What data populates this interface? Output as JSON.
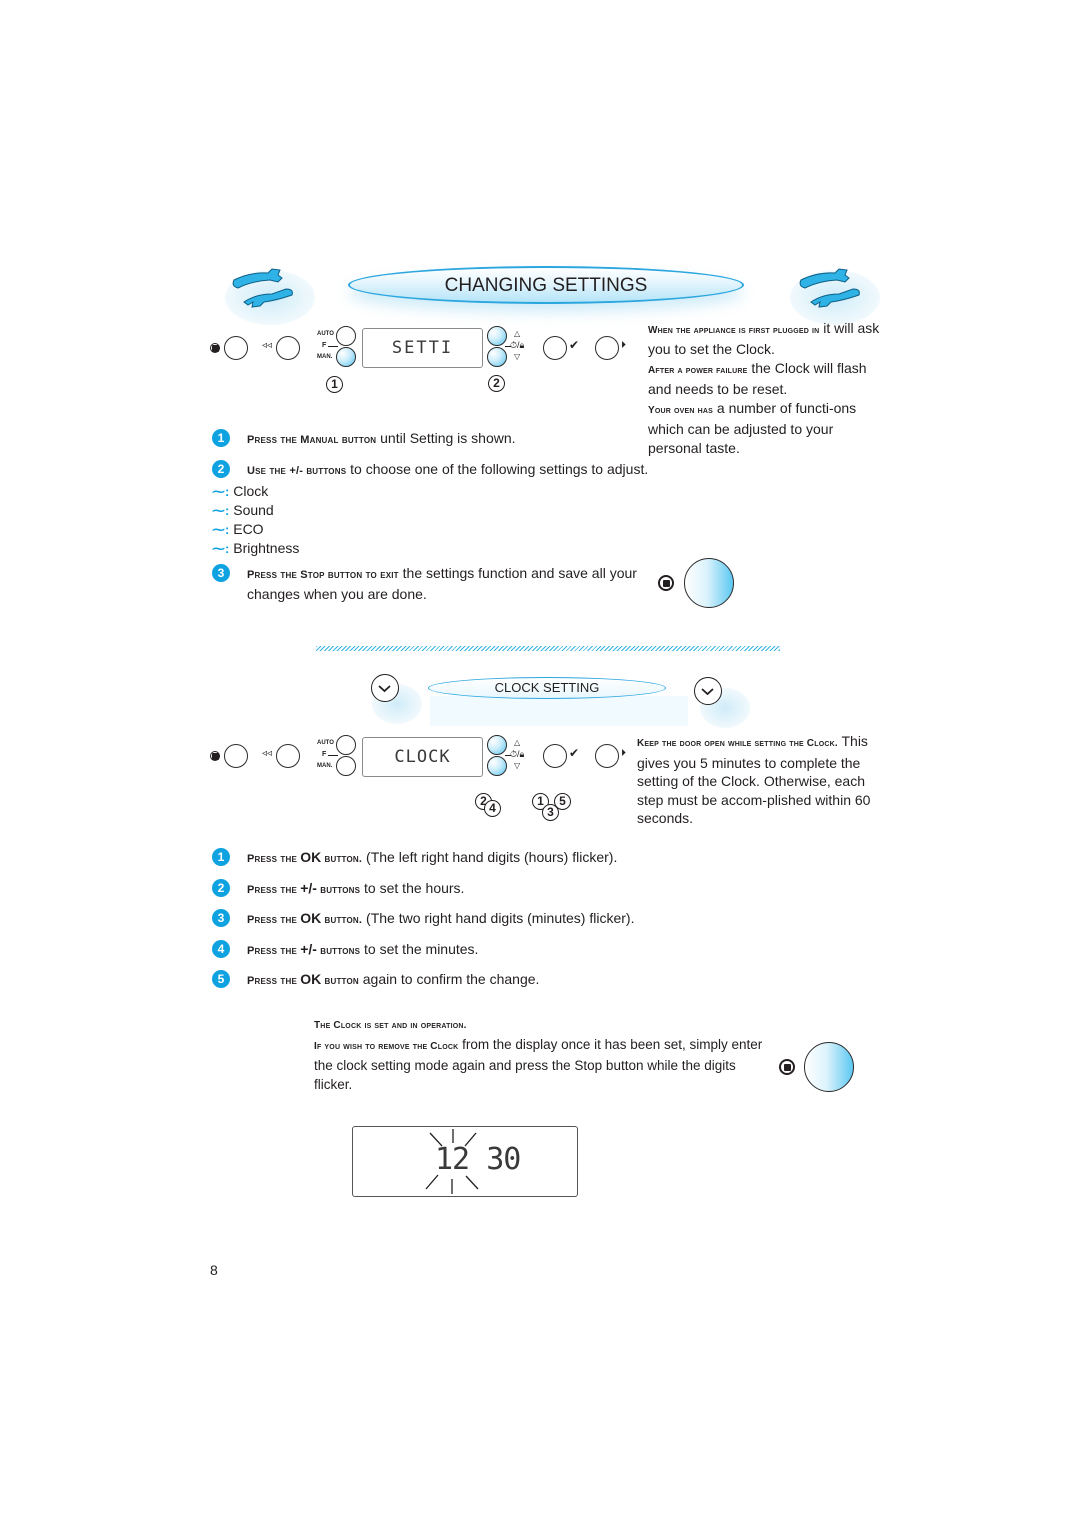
{
  "header": {
    "title": "CHANGING SETTINGS",
    "icon_left": "wrench-pair-icon",
    "icon_right": "wrench-pair-icon"
  },
  "panel1": {
    "lcd_text": "SETTI",
    "auto_label": "AUTO",
    "f_label": "F",
    "man_label": "MAN.",
    "callouts": [
      "1",
      "2"
    ]
  },
  "intro_note": {
    "lead1": "When the appliance is first plugged in",
    "text1": " it will ask you to set the Clock.",
    "lead2": "After a power failure",
    "text2": " the Clock will flash and needs to be reset.",
    "lead3": "Your oven has",
    "text3": " a number of functi-ons which can be adjusted to your personal taste."
  },
  "settings_steps": [
    {
      "num": "1",
      "lead": "Press the Manual button",
      "text": " until Setting is shown."
    },
    {
      "num": "2",
      "lead": "Use the +/- buttons",
      "text": " to choose one of the following settings to adjust."
    },
    {
      "num": "3",
      "lead": "Press the Stop button to exit",
      "text": " the settings function and save all your changes when you are done."
    }
  ],
  "settings_list": [
    "Clock",
    "Sound",
    "ECO",
    "Brightness"
  ],
  "clock_section": {
    "title": "CLOCK SETTING",
    "lcd_text": "CLOCK",
    "callouts_left": [
      "2",
      "4"
    ],
    "callouts_right": [
      "1",
      "3",
      "5"
    ],
    "note_lead": "Keep the door open while setting the Clock.",
    "note_text": " This gives you 5 minutes to complete the setting of the Clock. Otherwise, each step must be accom-plished within 60 seconds."
  },
  "clock_steps": [
    {
      "num": "1",
      "lead": "Press the ",
      "key": "OK",
      "lead2": " button.",
      "text": " (The left right hand digits (hours) flicker)."
    },
    {
      "num": "2",
      "lead": "Press the ",
      "key": "+/-",
      "lead2": " buttons",
      "text": " to set the hours."
    },
    {
      "num": "3",
      "lead": "Press the ",
      "key": "OK",
      "lead2": " button.",
      "text": " (The two right hand digits (minutes) flicker)."
    },
    {
      "num": "4",
      "lead": "Press the ",
      "key": "+/-",
      "lead2": " buttons",
      "text": " to set the minutes."
    },
    {
      "num": "5",
      "lead": "Press the ",
      "key": "OK",
      "lead2": " button",
      "text": " again to confirm the change."
    }
  ],
  "footer_note": {
    "line1": "The Clock is set and in operation.",
    "lead2": "If you wish to remove the Clock",
    "text2": " from the display once it has been set, simply enter the clock setting mode again and press the Stop button while the digits flicker."
  },
  "final_display": {
    "hours": "12",
    "minutes": "30"
  },
  "page_number": "8",
  "colors": {
    "accent": "#0fa2e0",
    "text": "#231f20",
    "banner_border": "#2ba6de"
  }
}
